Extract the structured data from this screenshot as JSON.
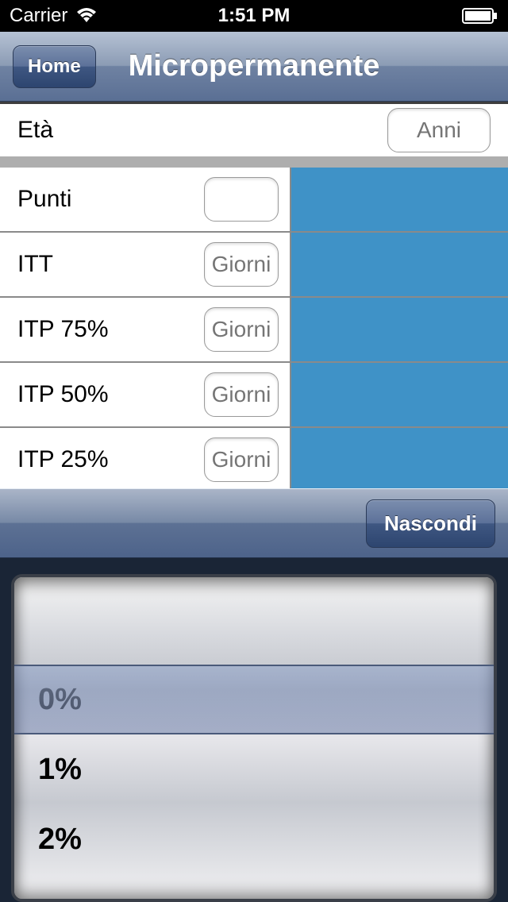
{
  "status": {
    "carrier": "Carrier",
    "time": "1:51 PM"
  },
  "nav": {
    "home_label": "Home",
    "title": "Micropermanente"
  },
  "rows": {
    "eta": {
      "label": "Età",
      "placeholder": "Anni"
    },
    "punti": {
      "label": "Punti",
      "placeholder": ""
    },
    "itt": {
      "label": "ITT",
      "placeholder": "Giorni"
    },
    "itp75": {
      "label": "ITP 75%",
      "placeholder": "Giorni"
    },
    "itp50": {
      "label": "ITP 50%",
      "placeholder": "Giorni"
    },
    "itp25": {
      "label": "ITP 25%",
      "placeholder": "Giorni"
    }
  },
  "toolbar": {
    "hide_label": "Nascondi"
  },
  "picker": {
    "options": [
      "0%",
      "1%",
      "2%"
    ],
    "opt0": "0%",
    "opt1": "1%",
    "opt2": "2%",
    "selected": "0%"
  }
}
